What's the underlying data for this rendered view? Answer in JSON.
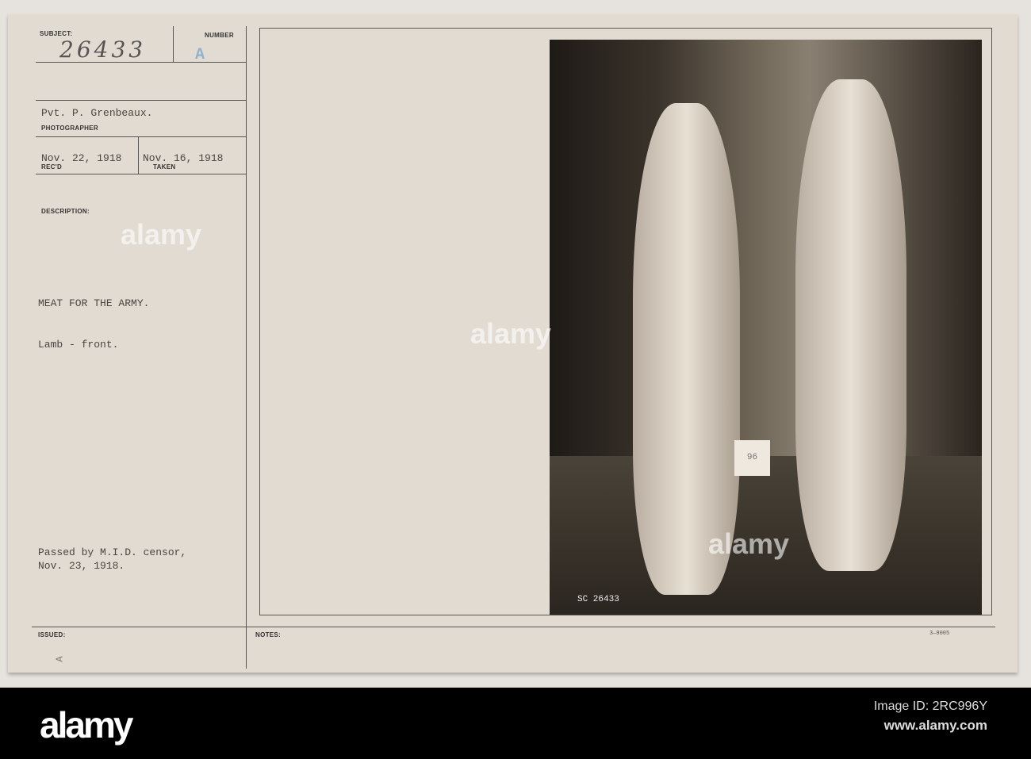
{
  "card": {
    "subject_label": "SUBJECT:",
    "subject_value": "26433",
    "number_label": "NUMBER",
    "number_value": "A",
    "photographer_value": "Pvt. P. Grenbeaux.",
    "photographer_label": "PHOTOGRAPHER",
    "recd_value": "Nov. 22, 1918",
    "recd_label": "REC'D",
    "taken_value": "Nov. 16, 1918",
    "taken_label": "TAKEN",
    "description_label": "DESCRIPTION:",
    "description_line1": "MEAT FOR THE ARMY.",
    "description_line2": "Lamb - front.",
    "censor_line1": "Passed by M.I.D. censor,",
    "censor_line2": "Nov. 23, 1918.",
    "issued_label": "ISSUED:",
    "issued_mark": "A",
    "notes_label": "NOTES:",
    "form_code": "3—9005",
    "photo_tag": "96",
    "negative_number": "SC 26433",
    "number_color": "#8fb3cc"
  },
  "footer": {
    "logo": "alamy",
    "image_id": "Image ID: 2RC996Y",
    "url": "www.alamy.com"
  },
  "watermark": "alamy"
}
